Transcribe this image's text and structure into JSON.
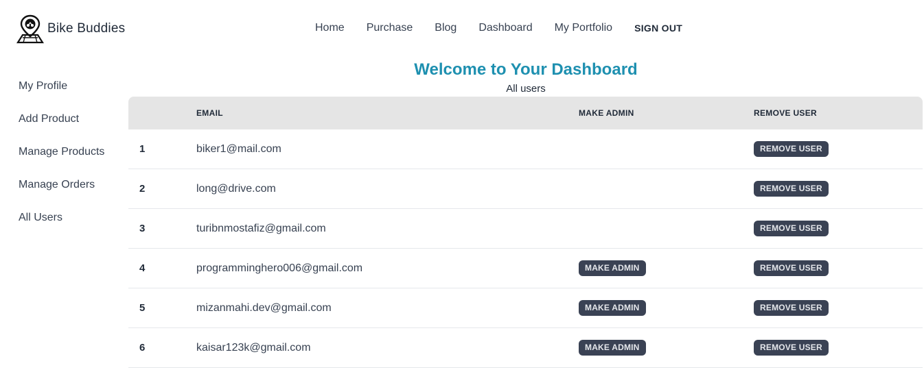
{
  "brand": {
    "name": "Bike Buddies",
    "logo_icon": "map-pin-bike-icon"
  },
  "nav": {
    "items": [
      "Home",
      "Purchase",
      "Blog",
      "Dashboard",
      "My Portfolio"
    ],
    "signout": "SIGN OUT"
  },
  "sidebar": {
    "items": [
      "My Profile",
      "Add Product",
      "Manage Products",
      "Manage Orders",
      "All Users"
    ]
  },
  "main": {
    "title": "Welcome to Your Dashboard",
    "subtitle": "All users",
    "colors": {
      "title": "#1e90b0",
      "button_bg": "#3a4254",
      "header_bg": "#e5e5e5"
    }
  },
  "table": {
    "headers": {
      "num": "",
      "email": "EMAIL",
      "admin": "MAKE ADMIN",
      "remove": "REMOVE USER"
    },
    "make_admin_label": "MAKE ADMIN",
    "remove_label": "REMOVE USER",
    "rows": [
      {
        "num": "1",
        "email": "biker1@mail.com",
        "show_make_admin": false
      },
      {
        "num": "2",
        "email": "long@drive.com",
        "show_make_admin": false
      },
      {
        "num": "3",
        "email": "turibnmostafiz@gmail.com",
        "show_make_admin": false
      },
      {
        "num": "4",
        "email": "programminghero006@gmail.com",
        "show_make_admin": true
      },
      {
        "num": "5",
        "email": "mizanmahi.dev@gmail.com",
        "show_make_admin": true
      },
      {
        "num": "6",
        "email": "kaisar123k@gmail.com",
        "show_make_admin": true
      }
    ]
  }
}
